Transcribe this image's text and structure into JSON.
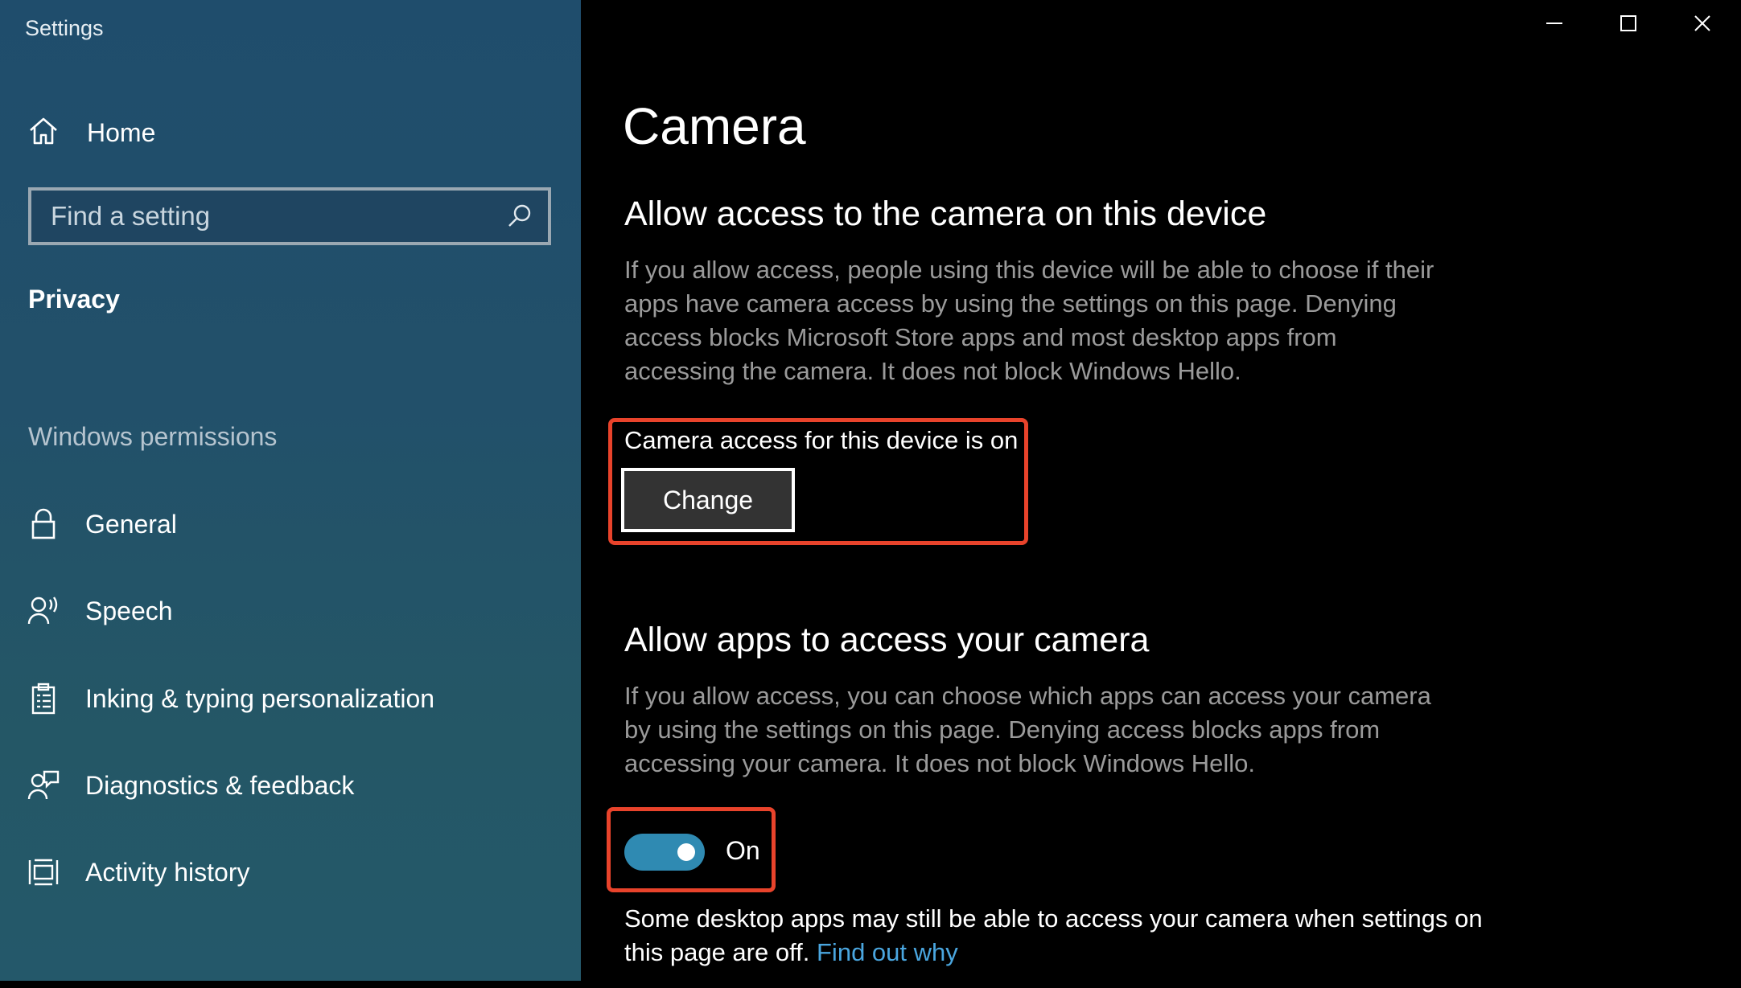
{
  "window": {
    "title": "Settings",
    "controls": {
      "minimize": "minimize-icon",
      "maximize": "maximize-icon",
      "close": "close-icon"
    }
  },
  "sidebar": {
    "home_label": "Home",
    "search": {
      "placeholder": "Find a setting",
      "value": ""
    },
    "section_privacy": "Privacy",
    "section_permissions": "Windows permissions",
    "items": [
      {
        "label": "General",
        "icon": "lock-icon"
      },
      {
        "label": "Speech",
        "icon": "speech-icon"
      },
      {
        "label": "Inking & typing personalization",
        "icon": "clipboard-icon"
      },
      {
        "label": "Diagnostics & feedback",
        "icon": "feedback-icon"
      },
      {
        "label": "Activity history",
        "icon": "activity-history-icon"
      }
    ]
  },
  "main": {
    "page_title": "Camera",
    "device_section": {
      "heading": "Allow access to the camera on this device",
      "description": "If you allow access, people using this device will be able to choose if their apps have camera access by using the settings on this page. Denying access blocks Microsoft Store apps and most desktop apps from accessing the camera. It does not block Windows Hello.",
      "status": "Camera access for this device is on",
      "change_label": "Change"
    },
    "apps_section": {
      "heading": "Allow apps to access your camera",
      "description": "If you allow access, you can choose which apps can access your camera by using the settings on this page. Denying access blocks apps from accessing your camera. It does not block Windows Hello.",
      "toggle_state": "On",
      "note": "Some desktop apps may still be able to access your camera when settings on this page are off.",
      "link": "Find out why"
    }
  },
  "colors": {
    "accent_toggle": "#2f8ab2",
    "link": "#4aa6df",
    "highlight": "#e8432b"
  }
}
